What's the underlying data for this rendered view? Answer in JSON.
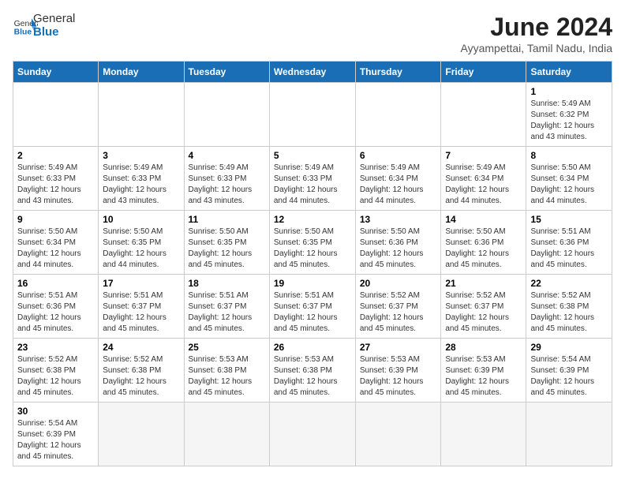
{
  "logo": {
    "text_general": "General",
    "text_blue": "Blue"
  },
  "header": {
    "month_year": "June 2024",
    "location": "Ayyampettai, Tamil Nadu, India"
  },
  "weekdays": [
    "Sunday",
    "Monday",
    "Tuesday",
    "Wednesday",
    "Thursday",
    "Friday",
    "Saturday"
  ],
  "weeks": [
    [
      {
        "day": "",
        "info": ""
      },
      {
        "day": "",
        "info": ""
      },
      {
        "day": "",
        "info": ""
      },
      {
        "day": "",
        "info": ""
      },
      {
        "day": "",
        "info": ""
      },
      {
        "day": "",
        "info": ""
      },
      {
        "day": "1",
        "info": "Sunrise: 5:49 AM\nSunset: 6:32 PM\nDaylight: 12 hours\nand 43 minutes."
      }
    ],
    [
      {
        "day": "2",
        "info": "Sunrise: 5:49 AM\nSunset: 6:33 PM\nDaylight: 12 hours\nand 43 minutes."
      },
      {
        "day": "3",
        "info": "Sunrise: 5:49 AM\nSunset: 6:33 PM\nDaylight: 12 hours\nand 43 minutes."
      },
      {
        "day": "4",
        "info": "Sunrise: 5:49 AM\nSunset: 6:33 PM\nDaylight: 12 hours\nand 43 minutes."
      },
      {
        "day": "5",
        "info": "Sunrise: 5:49 AM\nSunset: 6:33 PM\nDaylight: 12 hours\nand 44 minutes."
      },
      {
        "day": "6",
        "info": "Sunrise: 5:49 AM\nSunset: 6:34 PM\nDaylight: 12 hours\nand 44 minutes."
      },
      {
        "day": "7",
        "info": "Sunrise: 5:49 AM\nSunset: 6:34 PM\nDaylight: 12 hours\nand 44 minutes."
      },
      {
        "day": "8",
        "info": "Sunrise: 5:50 AM\nSunset: 6:34 PM\nDaylight: 12 hours\nand 44 minutes."
      }
    ],
    [
      {
        "day": "9",
        "info": "Sunrise: 5:50 AM\nSunset: 6:34 PM\nDaylight: 12 hours\nand 44 minutes."
      },
      {
        "day": "10",
        "info": "Sunrise: 5:50 AM\nSunset: 6:35 PM\nDaylight: 12 hours\nand 44 minutes."
      },
      {
        "day": "11",
        "info": "Sunrise: 5:50 AM\nSunset: 6:35 PM\nDaylight: 12 hours\nand 45 minutes."
      },
      {
        "day": "12",
        "info": "Sunrise: 5:50 AM\nSunset: 6:35 PM\nDaylight: 12 hours\nand 45 minutes."
      },
      {
        "day": "13",
        "info": "Sunrise: 5:50 AM\nSunset: 6:36 PM\nDaylight: 12 hours\nand 45 minutes."
      },
      {
        "day": "14",
        "info": "Sunrise: 5:50 AM\nSunset: 6:36 PM\nDaylight: 12 hours\nand 45 minutes."
      },
      {
        "day": "15",
        "info": "Sunrise: 5:51 AM\nSunset: 6:36 PM\nDaylight: 12 hours\nand 45 minutes."
      }
    ],
    [
      {
        "day": "16",
        "info": "Sunrise: 5:51 AM\nSunset: 6:36 PM\nDaylight: 12 hours\nand 45 minutes."
      },
      {
        "day": "17",
        "info": "Sunrise: 5:51 AM\nSunset: 6:37 PM\nDaylight: 12 hours\nand 45 minutes."
      },
      {
        "day": "18",
        "info": "Sunrise: 5:51 AM\nSunset: 6:37 PM\nDaylight: 12 hours\nand 45 minutes."
      },
      {
        "day": "19",
        "info": "Sunrise: 5:51 AM\nSunset: 6:37 PM\nDaylight: 12 hours\nand 45 minutes."
      },
      {
        "day": "20",
        "info": "Sunrise: 5:52 AM\nSunset: 6:37 PM\nDaylight: 12 hours\nand 45 minutes."
      },
      {
        "day": "21",
        "info": "Sunrise: 5:52 AM\nSunset: 6:37 PM\nDaylight: 12 hours\nand 45 minutes."
      },
      {
        "day": "22",
        "info": "Sunrise: 5:52 AM\nSunset: 6:38 PM\nDaylight: 12 hours\nand 45 minutes."
      }
    ],
    [
      {
        "day": "23",
        "info": "Sunrise: 5:52 AM\nSunset: 6:38 PM\nDaylight: 12 hours\nand 45 minutes."
      },
      {
        "day": "24",
        "info": "Sunrise: 5:52 AM\nSunset: 6:38 PM\nDaylight: 12 hours\nand 45 minutes."
      },
      {
        "day": "25",
        "info": "Sunrise: 5:53 AM\nSunset: 6:38 PM\nDaylight: 12 hours\nand 45 minutes."
      },
      {
        "day": "26",
        "info": "Sunrise: 5:53 AM\nSunset: 6:38 PM\nDaylight: 12 hours\nand 45 minutes."
      },
      {
        "day": "27",
        "info": "Sunrise: 5:53 AM\nSunset: 6:39 PM\nDaylight: 12 hours\nand 45 minutes."
      },
      {
        "day": "28",
        "info": "Sunrise: 5:53 AM\nSunset: 6:39 PM\nDaylight: 12 hours\nand 45 minutes."
      },
      {
        "day": "29",
        "info": "Sunrise: 5:54 AM\nSunset: 6:39 PM\nDaylight: 12 hours\nand 45 minutes."
      }
    ],
    [
      {
        "day": "30",
        "info": "Sunrise: 5:54 AM\nSunset: 6:39 PM\nDaylight: 12 hours\nand 45 minutes."
      },
      {
        "day": "",
        "info": ""
      },
      {
        "day": "",
        "info": ""
      },
      {
        "day": "",
        "info": ""
      },
      {
        "day": "",
        "info": ""
      },
      {
        "day": "",
        "info": ""
      },
      {
        "day": "",
        "info": ""
      }
    ]
  ]
}
